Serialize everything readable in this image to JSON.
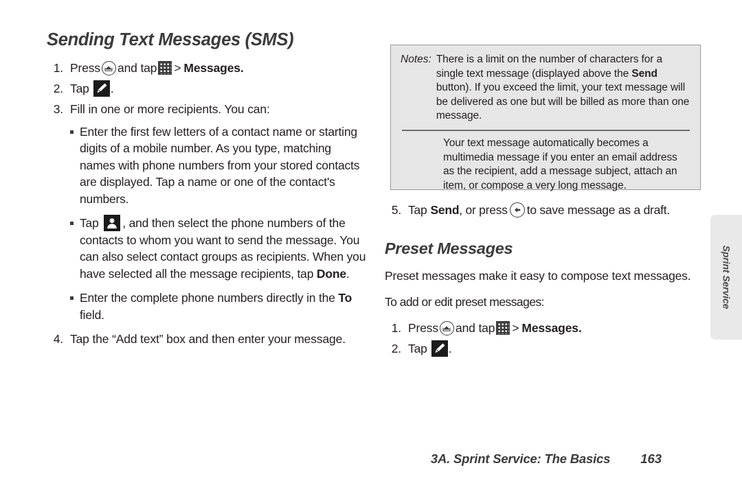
{
  "page": {
    "footer_title": "3A. Sprint Service: The Basics",
    "page_number": "163",
    "side_tab_label": "Sprint Service"
  },
  "left_column": {
    "heading": "Sending Text Messages (SMS)",
    "step1": {
      "number": "1.",
      "text_before_home": "Press",
      "text_between": "and tap",
      "separator": ">",
      "target": "Messages.",
      "home_icon": "home-icon",
      "grid_icon": "app-grid-icon"
    },
    "step2": {
      "number": "2.",
      "text": "Tap",
      "compose_icon": "compose-pencil-icon",
      "period": "."
    },
    "step3": {
      "number": "3.",
      "text": "Fill in one or more recipients. You can:",
      "bullets": [
        {
          "text": "Enter the first few letters of a contact name or starting digits of a mobile number. As you type, matching names with phone numbers from your stored contacts are displayed. Tap a name or one of the contact's numbers."
        },
        {
          "lead": "Tap",
          "icon": "contacts-person-icon",
          "text_after": ", and then select the phone numbers of the contacts to whom you want to send the message. You can also select contact groups as recipients. When you have selected all the message recipients, tap",
          "bold_end": "Done",
          "end": "."
        },
        {
          "text_start": "Enter the complete phone numbers directly in the",
          "bold": "To",
          "text_end": "field."
        }
      ]
    },
    "step4": {
      "number": "4.",
      "text": "Tap the “Add text” box and then enter your message."
    }
  },
  "right_column": {
    "notes": {
      "label": "Notes:",
      "note1_part1": "There is a limit on the number of characters for a single text message (displayed above the",
      "note1_bold": "Send",
      "note1_part2": "button). If you exceed the limit, your text message will be delivered as one but will be billed as more than one message.",
      "note2": "Your text message automatically becomes a multimedia message if you enter an email address as the recipient, add a message subject, attach an item, or compose a very long message."
    },
    "step5": {
      "number": "5.",
      "text_before": "Tap",
      "bold": "Send",
      "text_middle": ", or press",
      "back_icon": "back-arrow-icon",
      "text_after": "to save message as a draft."
    },
    "heading": "Preset Messages",
    "paragraph": "Preset messages make it easy to compose text messages.",
    "subhead": "To add or edit preset messages:",
    "step1": {
      "number": "1.",
      "text_before_home": "Press",
      "text_between": "and tap",
      "separator": ">",
      "target": "Messages.",
      "home_icon": "home-icon",
      "grid_icon": "app-grid-icon"
    },
    "step2": {
      "number": "2.",
      "text": "Tap",
      "compose_icon": "compose-pencil-icon",
      "period": "."
    }
  },
  "colors": {
    "text": "#231f20",
    "notes_background": "#e6e6e6",
    "notes_border": "#9a9a9a",
    "side_tab_background": "#e9e9e9"
  }
}
